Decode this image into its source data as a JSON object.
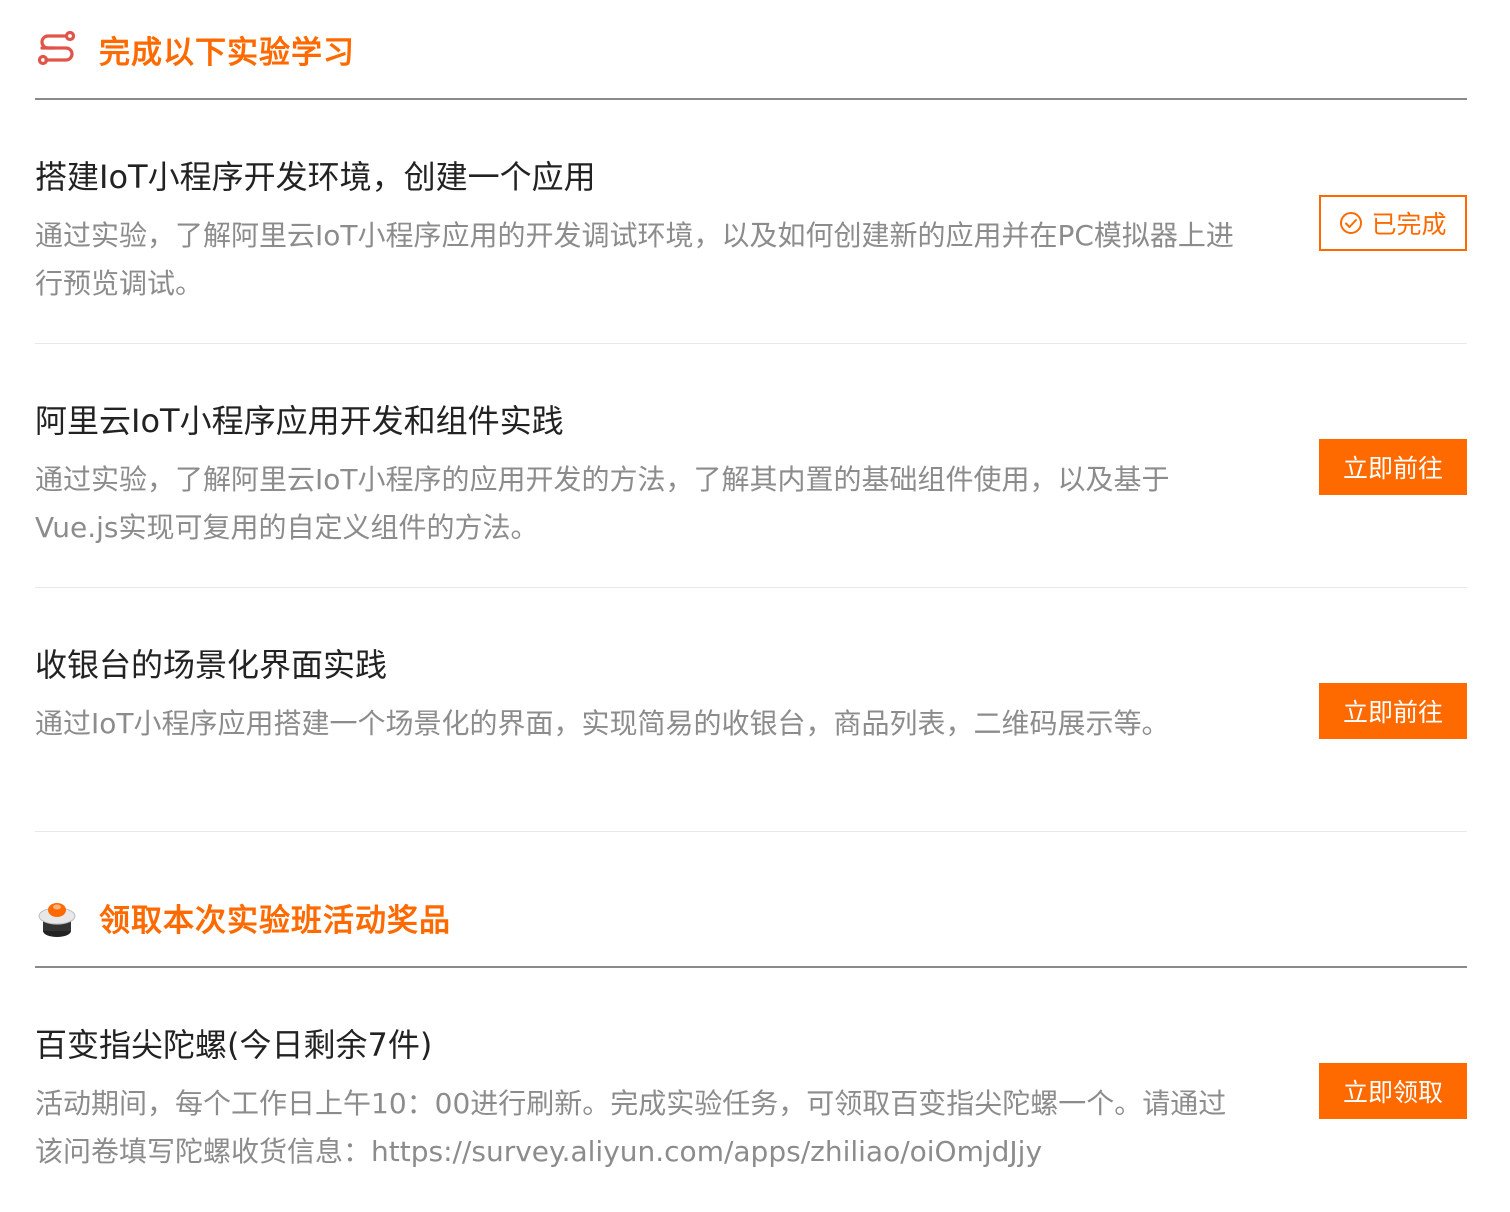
{
  "colors": {
    "accent": "#ff6a00",
    "title_text": "#222222",
    "desc_text": "#8c8c8c",
    "divider": "#e8e8e8",
    "header_rule": "#8a8a8a"
  },
  "experiments_section": {
    "icon": "route-icon",
    "title": "完成以下实验学习",
    "items": [
      {
        "title": "搭建IoT小程序开发环境，创建一个应用",
        "description": "通过实验，了解阿里云IoT小程序应用的开发调试环境，以及如何创建新的应用并在PC模拟器上进行预览调试。",
        "action_label": "已完成",
        "action_state": "completed",
        "action_icon": "check-circle-icon"
      },
      {
        "title": "阿里云IoT小程序应用开发和组件实践",
        "description": "通过实验，了解阿里云IoT小程序的应用开发的方法，了解其内置的基础组件使用，以及基于Vue.js实现可复用的自定义组件的方法。",
        "action_label": "立即前往",
        "action_state": "go"
      },
      {
        "title": "收银台的场景化界面实践",
        "description": "通过IoT小程序应用搭建一个场景化的界面，实现简易的收银台，商品列表，二维码展示等。",
        "action_label": "立即前往",
        "action_state": "go"
      }
    ]
  },
  "reward_section": {
    "icon": "gyroscope-prize-icon",
    "title": "领取本次实验班活动奖品",
    "items": [
      {
        "title": "百变指尖陀螺(今日剩余7件)",
        "description": "活动期间，每个工作日上午10：00进行刷新。完成实验任务，可领取百变指尖陀螺一个。请通过该问卷填写陀螺收货信息：https://survey.aliyun.com/apps/zhiliao/oiOmjdJjy",
        "action_label": "立即领取",
        "action_state": "claim"
      }
    ]
  }
}
